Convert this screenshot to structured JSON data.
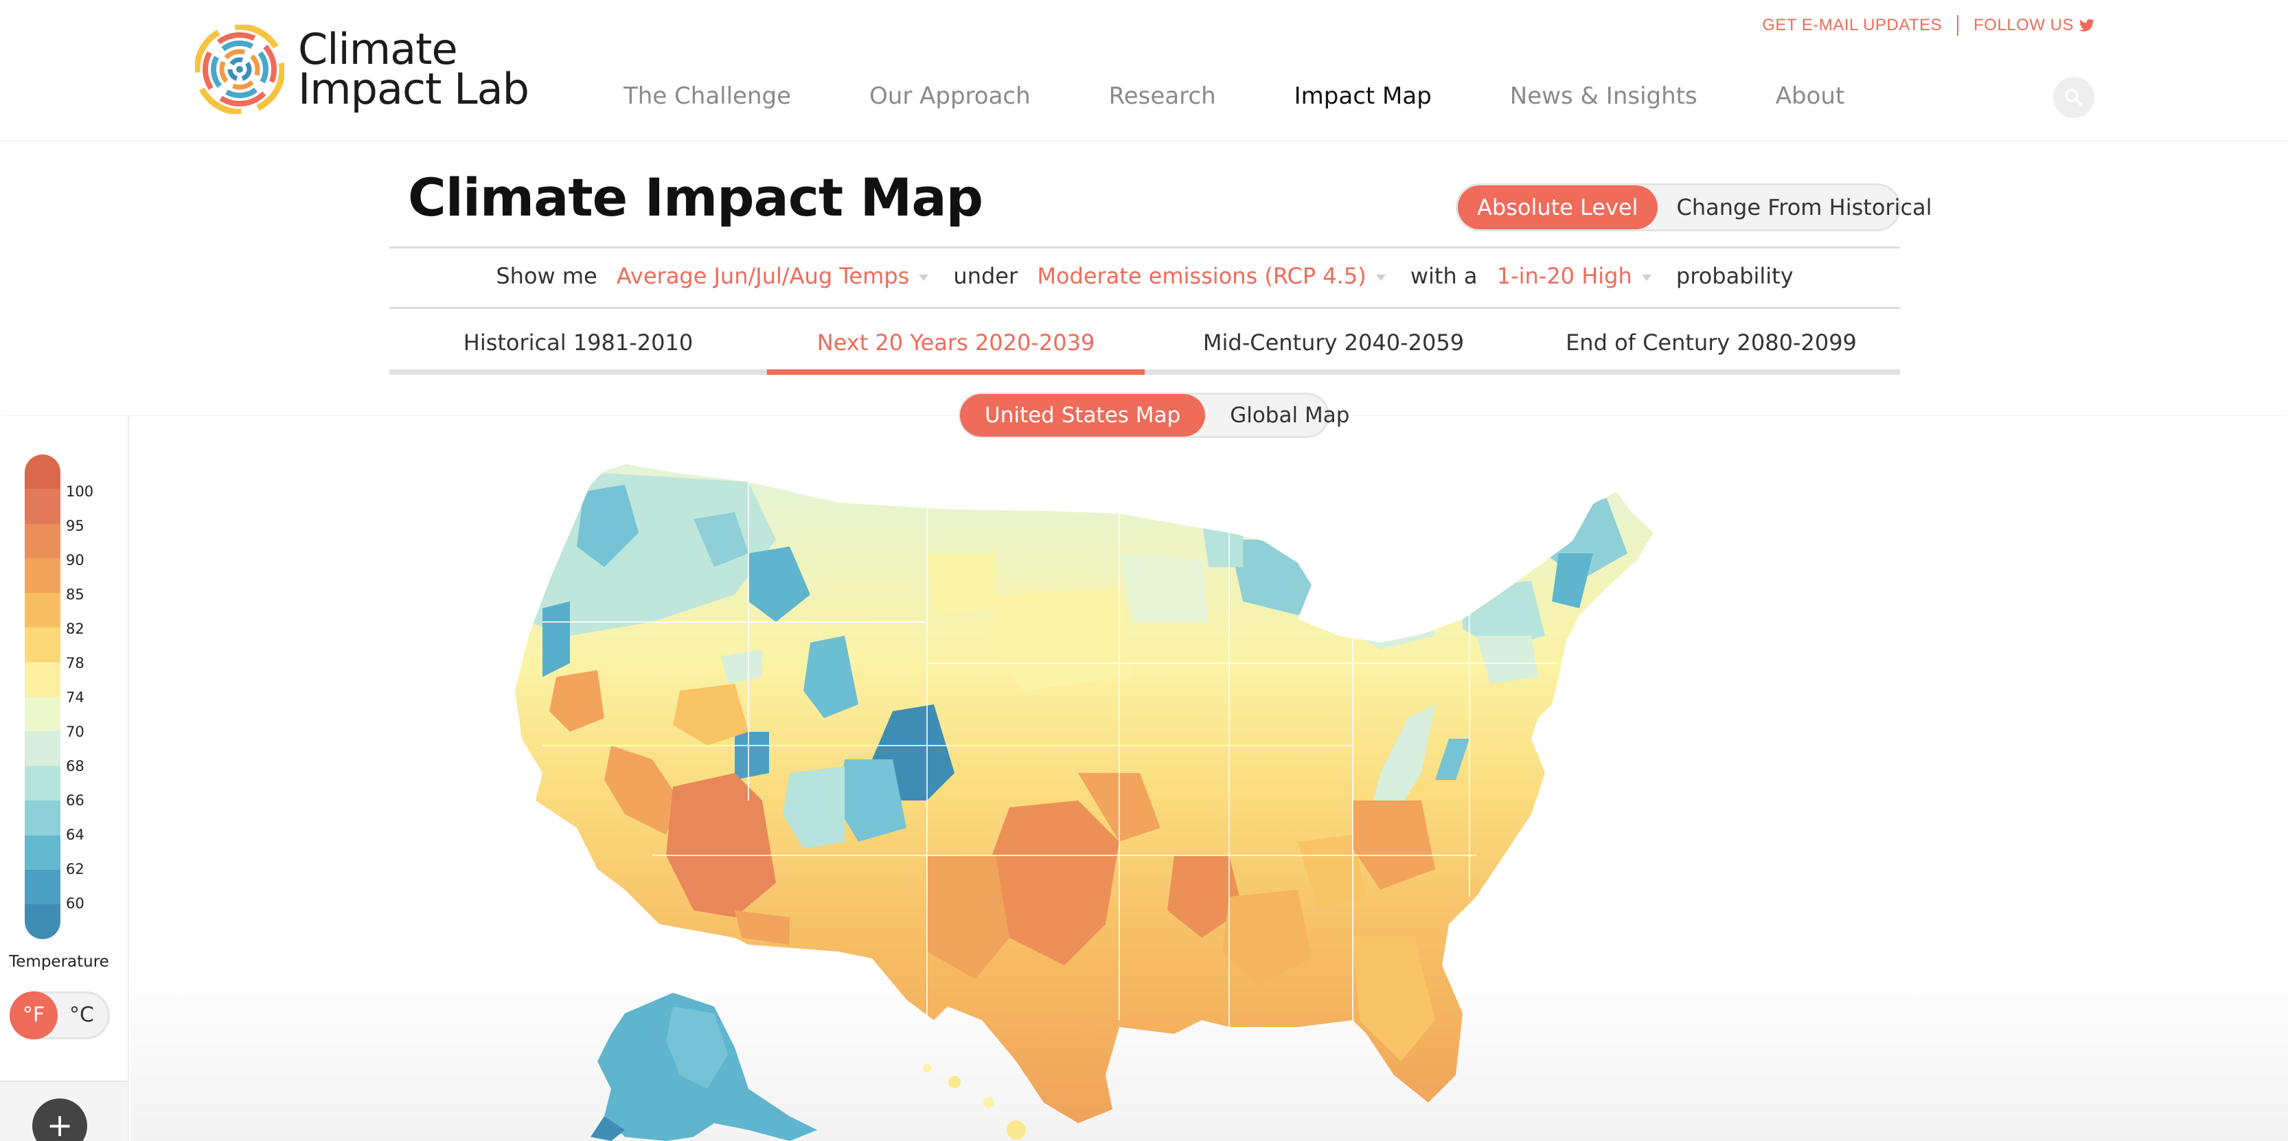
{
  "header": {
    "logo_line1": "Climate",
    "logo_line2": "Impact Lab",
    "email_updates": "GET E-MAIL UPDATES",
    "follow_us": "FOLLOW US",
    "nav": [
      "The Challenge",
      "Our Approach",
      "Research",
      "Impact Map",
      "News & Insights",
      "About"
    ],
    "active_nav": "Impact Map"
  },
  "controls": {
    "title": "Climate Impact Map",
    "level_options": [
      "Absolute Level",
      "Change From Historical"
    ],
    "level_selected": "Absolute Level",
    "show_me": "Show me",
    "variable": "Average Jun/Jul/Aug Temps",
    "under": "under",
    "scenario": "Moderate emissions (RCP 4.5)",
    "with_a": "with a",
    "likelihood": "1-in-20 High",
    "probability": "probability",
    "periods": [
      "Historical 1981-2010",
      "Next 20 Years 2020-2039",
      "Mid-Century 2040-2059",
      "End of Century 2080-2099"
    ],
    "period_selected": "Next 20 Years 2020-2039",
    "map_options": [
      "United States Map",
      "Global Map"
    ],
    "map_selected": "United States Map"
  },
  "legend": {
    "title": "Temperature",
    "ticks": [
      "100",
      "95",
      "90",
      "85",
      "82",
      "78",
      "74",
      "70",
      "68",
      "66",
      "64",
      "62",
      "60"
    ],
    "units": [
      "°F",
      "°C"
    ],
    "unit_selected": "°F",
    "zoom_in": "+",
    "colors": [
      "#d9694a",
      "#e2795a",
      "#ea8e5a",
      "#f2a45c",
      "#f8bf62",
      "#fcd978",
      "#fdf0a0",
      "#edf7cc",
      "#d7efdc",
      "#b7e3dd",
      "#8ed0d7",
      "#65b9cf",
      "#4a9fc2",
      "#3f8db4"
    ]
  },
  "colors": {
    "accent": "#ef6b5a",
    "hot": "#e8875a",
    "warm": "#f5b45f",
    "mild": "#fbe98f",
    "cool": "#e6f4d6",
    "cold": "#75c3d4",
    "coldest": "#3f8db4"
  },
  "icons": {
    "search": "search-icon",
    "twitter": "twitter-icon",
    "logo": "climate-impact-lab-logo-icon"
  }
}
